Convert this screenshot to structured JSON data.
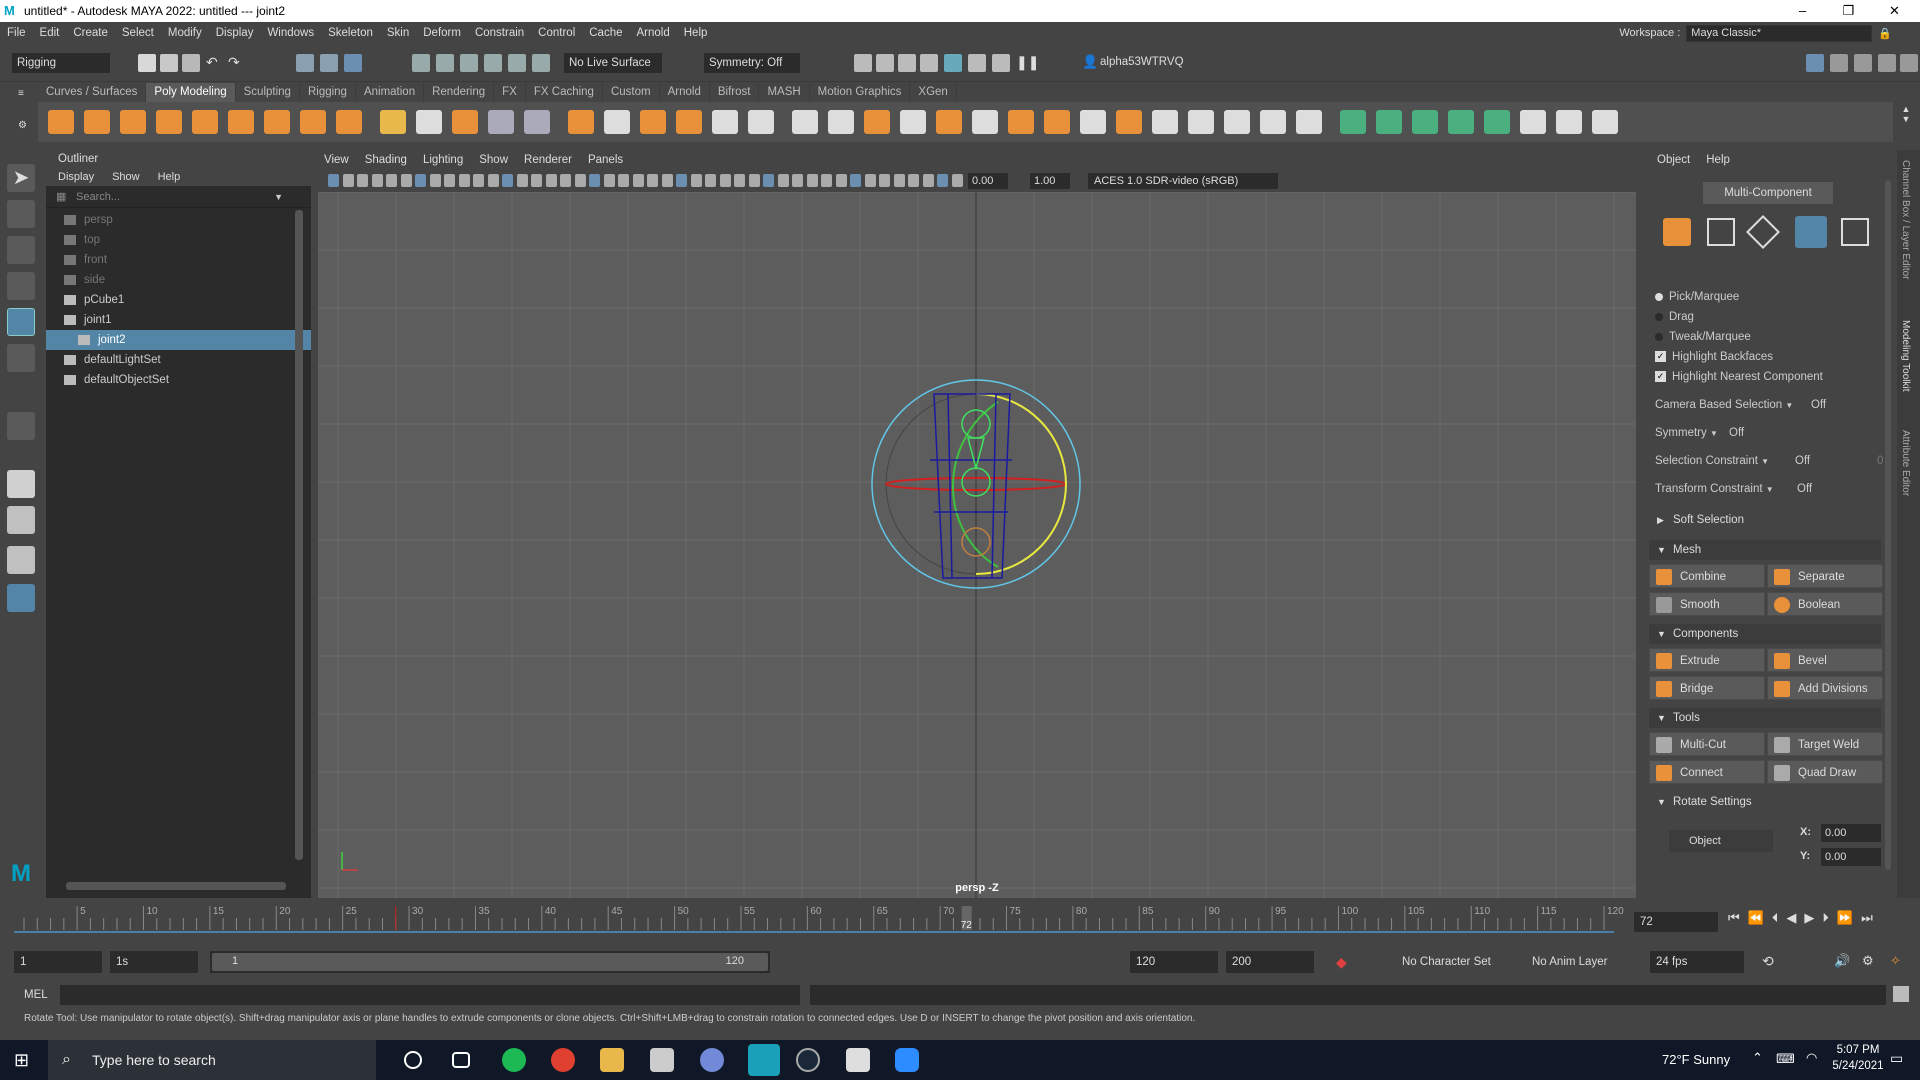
{
  "titlebar": {
    "title": "untitled* - Autodesk MAYA 2022: untitled   ---   joint2",
    "logo": "M"
  },
  "menu": [
    "File",
    "Edit",
    "Create",
    "Select",
    "Modify",
    "Display",
    "Windows",
    "Skeleton",
    "Skin",
    "Deform",
    "Constrain",
    "Control",
    "Cache",
    "Arnold",
    "Help"
  ],
  "workspace": {
    "label": "Workspace :",
    "value": "Maya Classic*"
  },
  "status": {
    "mode": "Rigging",
    "live_surface": "No Live Surface",
    "symmetry": "Symmetry: Off",
    "user": "alpha53WTRVQ"
  },
  "shelf_tabs": [
    "Curves / Surfaces",
    "Poly Modeling",
    "Sculpting",
    "Rigging",
    "Animation",
    "Rendering",
    "FX",
    "FX Caching",
    "Custom",
    "Arnold",
    "Bifrost",
    "MASH",
    "Motion Graphics",
    "XGen"
  ],
  "shelf_active": "Poly Modeling",
  "outliner": {
    "title": "Outliner",
    "menu": [
      "Display",
      "Show",
      "Help"
    ],
    "search_placeholder": "Search...",
    "items": [
      {
        "label": "persp",
        "dim": true,
        "indent": 0
      },
      {
        "label": "top",
        "dim": true,
        "indent": 0
      },
      {
        "label": "front",
        "dim": true,
        "indent": 0
      },
      {
        "label": "side",
        "dim": true,
        "indent": 0
      },
      {
        "label": "pCube1",
        "dim": false,
        "indent": 0
      },
      {
        "label": "joint1",
        "dim": false,
        "indent": 0,
        "expand": "−"
      },
      {
        "label": "joint2",
        "dim": false,
        "indent": 1,
        "selected": true
      },
      {
        "label": "defaultLightSet",
        "dim": false,
        "indent": 0
      },
      {
        "label": "defaultObjectSet",
        "dim": false,
        "indent": 0
      }
    ]
  },
  "viewport": {
    "menu": [
      "View",
      "Shading",
      "Lighting",
      "Show",
      "Renderer",
      "Panels"
    ],
    "exposure": "0.00",
    "gamma": "1.00",
    "colorspace": "ACES 1.0 SDR-video (sRGB)",
    "camera_label": "persp -Z"
  },
  "modeling_toolkit": {
    "menu": [
      "Object",
      "Help"
    ],
    "multi_component": "Multi-Component",
    "pick_marquee": "Pick/Marquee",
    "drag": "Drag",
    "tweak_marquee": "Tweak/Marquee",
    "highlight_backfaces": "Highlight Backfaces",
    "highlight_nearest": "Highlight Nearest Component",
    "camera_based": {
      "label": "Camera Based Selection",
      "value": "Off"
    },
    "symmetry": {
      "label": "Symmetry",
      "value": "Off"
    },
    "selection_constraint": {
      "label": "Selection Constraint",
      "value": "Off",
      "num": "0"
    },
    "transform_constraint": {
      "label": "Transform Constraint",
      "value": "Off"
    },
    "soft_selection": "Soft Selection",
    "mesh": {
      "title": "Mesh",
      "buttons": [
        "Combine",
        "Separate",
        "Smooth",
        "Boolean"
      ]
    },
    "components": {
      "title": "Components",
      "buttons": [
        "Extrude",
        "Bevel",
        "Bridge",
        "Add Divisions"
      ]
    },
    "tools": {
      "title": "Tools",
      "buttons": [
        "Multi-Cut",
        "Target Weld",
        "Connect",
        "Quad Draw"
      ]
    },
    "rotate_settings": {
      "title": "Rotate Settings",
      "object": "Object",
      "x": "0.00",
      "y": "0.00",
      "x_label": "X:",
      "y_label": "Y:"
    }
  },
  "side_tabs": [
    "Channel Box / Layer Editor",
    "Modeling Toolkit",
    "Attribute Editor"
  ],
  "timeline": {
    "ticks": [
      5,
      10,
      15,
      20,
      25,
      30,
      35,
      40,
      45,
      50,
      55,
      60,
      65,
      70,
      75,
      80,
      85,
      90,
      95,
      100,
      105,
      110,
      115,
      120
    ],
    "current": "72",
    "current_field": "72"
  },
  "range": {
    "start": "1",
    "start2": "1s",
    "inner_start": "1",
    "inner_end": "120",
    "end": "120",
    "end2": "200",
    "char_set": "No Character Set",
    "anim_layer": "No Anim Layer",
    "fps": "24 fps"
  },
  "cmd": {
    "lang": "MEL"
  },
  "help_text": "Rotate Tool: Use manipulator to rotate object(s). Shift+drag manipulator axis or plane handles to extrude components or clone objects. Ctrl+Shift+LMB+drag to constrain rotation to connected edges. Use D or INSERT to change the pivot position and axis orientation.",
  "taskbar": {
    "search": "Type here to search",
    "weather": "72°F  Sunny",
    "time": "5:07 PM",
    "date": "5/24/2021"
  }
}
